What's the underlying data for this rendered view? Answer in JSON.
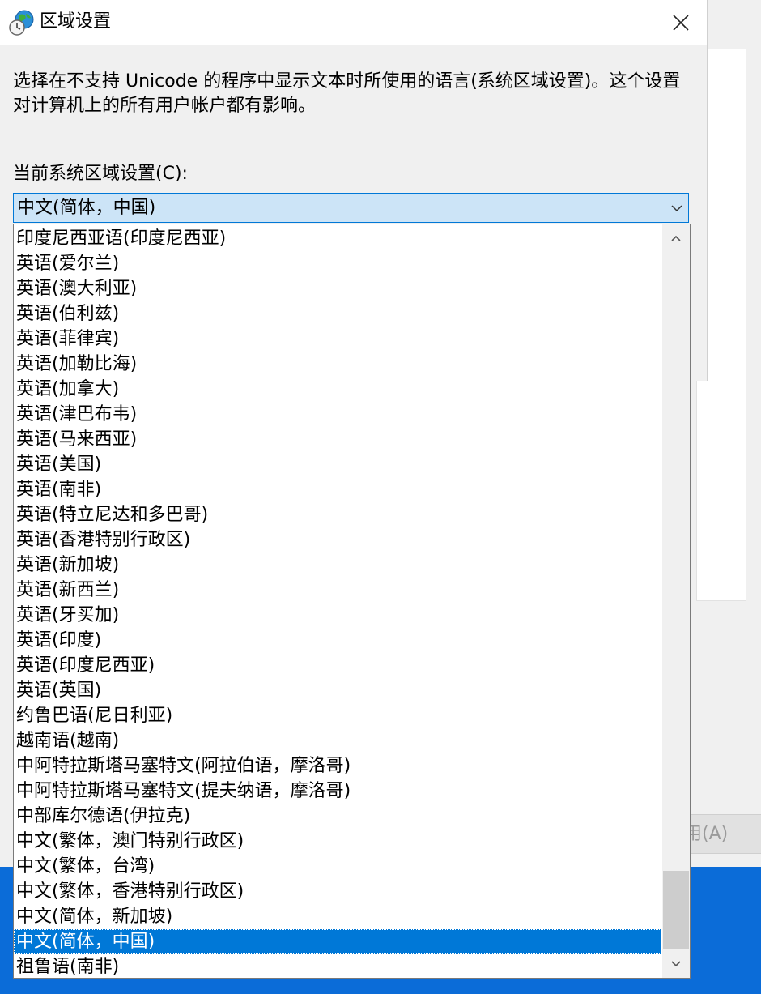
{
  "dialog": {
    "title": "区域设置",
    "description": "选择在不支持 Unicode 的程序中显示文本时所使用的语言(系统区域设置)。这个设置对计算机上的所有用户帐户都有影响。",
    "current_label": "当前系统区域设置(C):",
    "current_value": "中文(简体，中国)"
  },
  "background": {
    "apply_button": "用(A)"
  },
  "dropdown": {
    "items": [
      "印度尼西亚语(印度尼西亚)",
      "英语(爱尔兰)",
      "英语(澳大利亚)",
      "英语(伯利兹)",
      "英语(菲律宾)",
      "英语(加勒比海)",
      "英语(加拿大)",
      "英语(津巴布韦)",
      "英语(马来西亚)",
      "英语(美国)",
      "英语(南非)",
      "英语(特立尼达和多巴哥)",
      "英语(香港特别行政区)",
      "英语(新加坡)",
      "英语(新西兰)",
      "英语(牙买加)",
      "英语(印度)",
      "英语(印度尼西亚)",
      "英语(英国)",
      "约鲁巴语(尼日利亚)",
      "越南语(越南)",
      "中阿特拉斯塔马塞特文(阿拉伯语，摩洛哥)",
      "中阿特拉斯塔马塞特文(提夫纳语，摩洛哥)",
      "中部库尔德语(伊拉克)",
      "中文(繁体，澳门特别行政区)",
      "中文(繁体，台湾)",
      "中文(繁体，香港特别行政区)",
      "中文(简体，新加坡)",
      "中文(简体，中国)",
      "祖鲁语(南非)"
    ],
    "selected_index": 28
  },
  "colors": {
    "accent": "#0078d7",
    "combo_bg": "#cce4f7",
    "dialog_bg": "#f0f0f0"
  }
}
